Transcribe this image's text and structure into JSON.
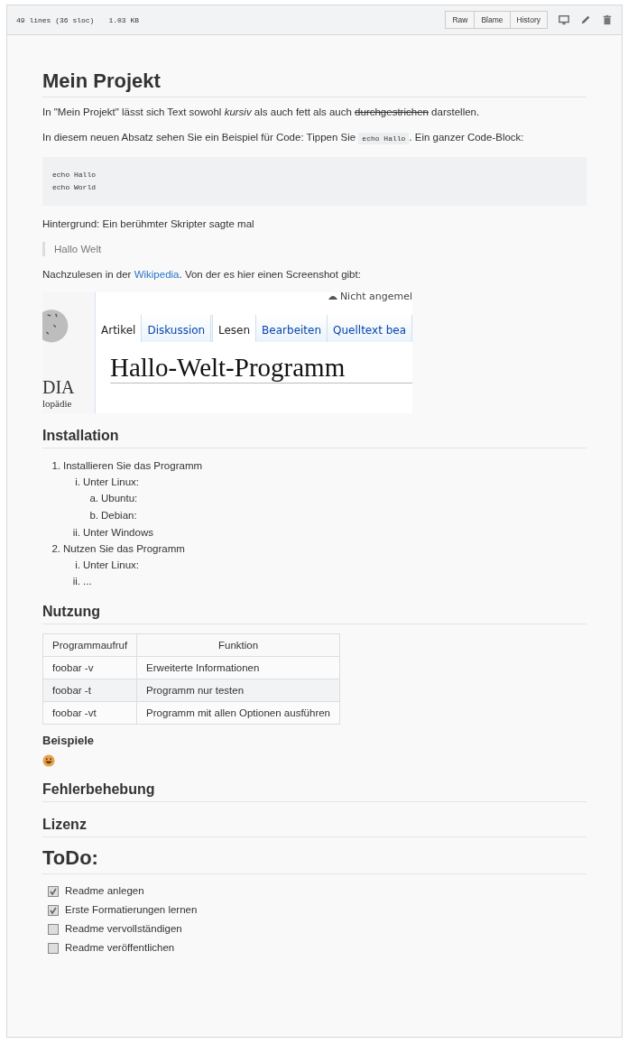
{
  "file_header": {
    "lines": "49 lines (36 sloc)",
    "size": "1.03 KB",
    "buttons": [
      "Raw",
      "Blame",
      "History"
    ]
  },
  "readme": [
    {
      "kind": "h1",
      "text": "Mein Projekt"
    },
    {
      "kind": "p",
      "segments": [
        {
          "kind": "plain",
          "text": "In \"Mein Projekt\" lässt sich Text sowohl "
        },
        {
          "kind": "italic",
          "text": "kursiv"
        },
        {
          "kind": "plain",
          "text": " als auch fett als auch "
        },
        {
          "kind": "strike",
          "text": "durchgestrichen"
        },
        {
          "kind": "plain",
          "text": " darstellen."
        }
      ]
    },
    {
      "kind": "p",
      "segments": [
        {
          "kind": "plain",
          "text": "In diesem neuen Absatz sehen Sie ein Beispiel für Code: Tippen Sie "
        },
        {
          "kind": "code",
          "text": "echo Hallo"
        },
        {
          "kind": "plain",
          "text": ". Ein ganzer Code-Block:"
        }
      ]
    },
    {
      "kind": "code",
      "lines": [
        "echo Hallo",
        "echo World"
      ]
    },
    {
      "kind": "p",
      "segments": [
        {
          "kind": "plain",
          "text": "Hintergrund: Ein berühmter Skripter sagte mal"
        }
      ]
    },
    {
      "kind": "blockquote",
      "text": "Hallo Welt"
    },
    {
      "kind": "p",
      "segments": [
        {
          "kind": "plain",
          "text": "Nachzulesen in der "
        },
        {
          "kind": "link",
          "text": "Wikipedia"
        },
        {
          "kind": "plain",
          "text": ". Von der es hier einen Screenshot gibt:"
        }
      ]
    },
    {
      "kind": "screenshot",
      "user": "Nicht angemel",
      "logo_word": "DIA",
      "logo_sub": "lopädie",
      "tabs": [
        {
          "label": "Artikel",
          "selected": true
        },
        {
          "label": "Diskussion",
          "selected": false
        },
        {
          "label": "Lesen",
          "selected": true
        },
        {
          "label": "Bearbeiten",
          "selected": false
        },
        {
          "label": "Quelltext bea",
          "selected": false
        }
      ],
      "title": "Hallo-Welt-Programm"
    },
    {
      "kind": "h2",
      "text": "Installation"
    },
    {
      "kind": "list",
      "items": [
        {
          "marker": "1.",
          "text": "Installieren Sie das Programm",
          "children": [
            {
              "marker": "i.",
              "text": "Unter Linux:",
              "children": [
                {
                  "marker": "a.",
                  "text": "Ubuntu:"
                },
                {
                  "marker": "b.",
                  "text": "Debian:"
                }
              ]
            },
            {
              "marker": "ii.",
              "text": "Unter Windows"
            }
          ]
        },
        {
          "marker": "2.",
          "text": "Nutzen Sie das Programm",
          "children": [
            {
              "marker": "i.",
              "text": "Unter Linux:"
            },
            {
              "marker": "ii.",
              "text": "..."
            }
          ]
        }
      ]
    },
    {
      "kind": "h2",
      "text": "Nutzung"
    },
    {
      "kind": "table",
      "columns": [
        "Programmaufruf",
        "Funktion"
      ],
      "rows": [
        [
          "foobar -v",
          "Erweiterte Informationen"
        ],
        [
          "foobar -t",
          "Programm nur testen"
        ],
        [
          "foobar -vt",
          "Programm mit allen Optionen ausführen"
        ]
      ]
    },
    {
      "kind": "h3",
      "text": "Beispiele"
    },
    {
      "kind": "emoji"
    },
    {
      "kind": "h2",
      "text": "Fehlerbehebung"
    },
    {
      "kind": "h2",
      "text": "Lizenz"
    },
    {
      "kind": "h1",
      "text": "ToDo:"
    },
    {
      "kind": "tasks",
      "items": [
        {
          "text": "Readme anlegen",
          "checked": true
        },
        {
          "text": "Erste Formatierungen lernen",
          "checked": true
        },
        {
          "text": "Readme vervollständigen",
          "checked": false
        },
        {
          "text": "Readme veröffentlichen",
          "checked": false
        }
      ]
    }
  ]
}
